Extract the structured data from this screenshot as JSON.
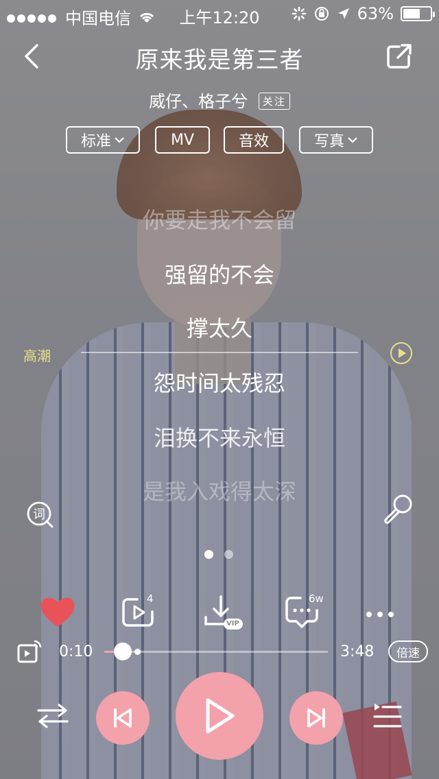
{
  "status_bar": {
    "carrier": "中国电信",
    "time": "上午12:20",
    "battery": "63%",
    "battery_level": 0.63
  },
  "header": {
    "title": "原来我是第三者",
    "artist": "威仔、格子兮",
    "follow_label": "关注"
  },
  "chips": [
    {
      "label": "标准",
      "has_dropdown": true
    },
    {
      "label": "MV",
      "has_dropdown": false
    },
    {
      "label": "音效",
      "has_dropdown": false
    },
    {
      "label": "写真",
      "has_dropdown": true
    }
  ],
  "lyrics": [
    {
      "text": "你要走我不会留",
      "state": "faded"
    },
    {
      "text": "强留的不会",
      "state": "normal"
    },
    {
      "text": "撑太久",
      "state": "normal"
    },
    {
      "text": "怨时间太残忍",
      "state": "normal"
    },
    {
      "text": "泪换不来永恒",
      "state": "dim"
    },
    {
      "text": "是我入戏得太深",
      "state": "faded"
    }
  ],
  "highlight": {
    "label": "高潮"
  },
  "actions": {
    "like_icon": "heart-icon",
    "share_count": "4",
    "download_badge": "VIP",
    "comment_count": "6w"
  },
  "progress": {
    "current": "0:10",
    "duration": "3:48",
    "played_fraction": 0.044,
    "speed_label": "倍速"
  },
  "colors": {
    "accent_pink": "#f3a1ab",
    "like_red": "#e8535a",
    "highlight_yellow": "#e9df8c"
  }
}
